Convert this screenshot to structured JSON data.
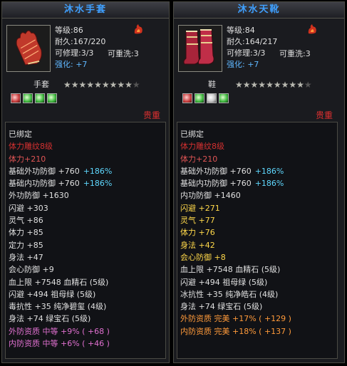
{
  "left": {
    "title": "沐水手套",
    "level": "等级:86",
    "durability": "耐久:167/220",
    "repair": "可修理:3/3",
    "rewash": "可重洗:3",
    "enhance_label": "强化:",
    "enhance_value": "+7",
    "type": "手套",
    "stars_filled": 9,
    "stars_total": 10,
    "gems": [
      "red",
      "green",
      "green",
      "green"
    ],
    "valuable": "贵重",
    "attrs": [
      {
        "text": "已绑定",
        "cls": ""
      },
      {
        "text": "体力雕纹8级",
        "cls": "red"
      },
      {
        "text": "体力+210",
        "cls": "pink"
      },
      {
        "text": "基础外功防御 +760",
        "extra": "+186%",
        "cls": ""
      },
      {
        "text": "基础内功防御 +760",
        "extra": "+186%",
        "cls": ""
      },
      {
        "text": "外功防御 +1630",
        "cls": ""
      },
      {
        "text": "闪避 +303",
        "cls": ""
      },
      {
        "text": "灵气 +86",
        "cls": ""
      },
      {
        "text": "体力 +85",
        "cls": ""
      },
      {
        "text": "定力 +85",
        "cls": ""
      },
      {
        "text": "身法 +47",
        "cls": ""
      },
      {
        "text": "会心防御 +9",
        "cls": ""
      },
      {
        "text": "血上限 +7548 血精石 (5级)",
        "cls": ""
      },
      {
        "text": "闪避 +494 祖母绿 (5级)",
        "cls": ""
      },
      {
        "text": "毒抗性 +35 纯净碧玺 (4级)",
        "cls": ""
      },
      {
        "text": "身法 +74 绿宝石 (5级)",
        "cls": ""
      },
      {
        "text": "外防资质   中等 +9% ( +68 )",
        "cls": "magenta"
      },
      {
        "text": "内防资质   中等 +6% ( +46 )",
        "cls": "magenta"
      }
    ]
  },
  "right": {
    "title": "沐水天靴",
    "level": "等级:84",
    "durability": "耐久:164/217",
    "repair": "可修理:3/3",
    "rewash": "可重洗:3",
    "enhance_label": "强化:",
    "enhance_value": "+7",
    "type": "鞋",
    "stars_filled": 9,
    "stars_total": 10,
    "gems": [
      "red",
      "green",
      "white",
      "green"
    ],
    "valuable": "贵重",
    "attrs": [
      {
        "text": "已绑定",
        "cls": ""
      },
      {
        "text": "体力雕纹8级",
        "cls": "red"
      },
      {
        "text": "体力+210",
        "cls": "pink"
      },
      {
        "text": "基础外功防御 +760",
        "extra": "+186%",
        "cls": ""
      },
      {
        "text": "基础内功防御 +760",
        "extra": "+186%",
        "cls": ""
      },
      {
        "text": "内功防御 +1460",
        "cls": ""
      },
      {
        "text": "闪避 +271",
        "cls": "yellow"
      },
      {
        "text": "灵气 +77",
        "cls": "yellow"
      },
      {
        "text": "体力 +76",
        "cls": "yellow"
      },
      {
        "text": "身法 +42",
        "cls": "yellow"
      },
      {
        "text": "会心防御 +8",
        "cls": "yellow"
      },
      {
        "text": "血上限 +7548 血精石 (5级)",
        "cls": ""
      },
      {
        "text": "闪避 +494 祖母绿 (5级)",
        "cls": ""
      },
      {
        "text": "冰抗性 +35 纯净皓石 (4级)",
        "cls": ""
      },
      {
        "text": "身法 +74 绿宝石 (5级)",
        "cls": ""
      },
      {
        "text": "外防资质   完美 +17% ( +129 )",
        "cls": "orange"
      },
      {
        "text": "内防资质   完美 +18% ( +137 )",
        "cls": "orange"
      }
    ]
  },
  "colors": {
    "title_blue": "#3fa0ff",
    "enhance_blue": "#5fb7ff",
    "valuable_red": "#e03030",
    "cyan": "#5fd8ff"
  }
}
